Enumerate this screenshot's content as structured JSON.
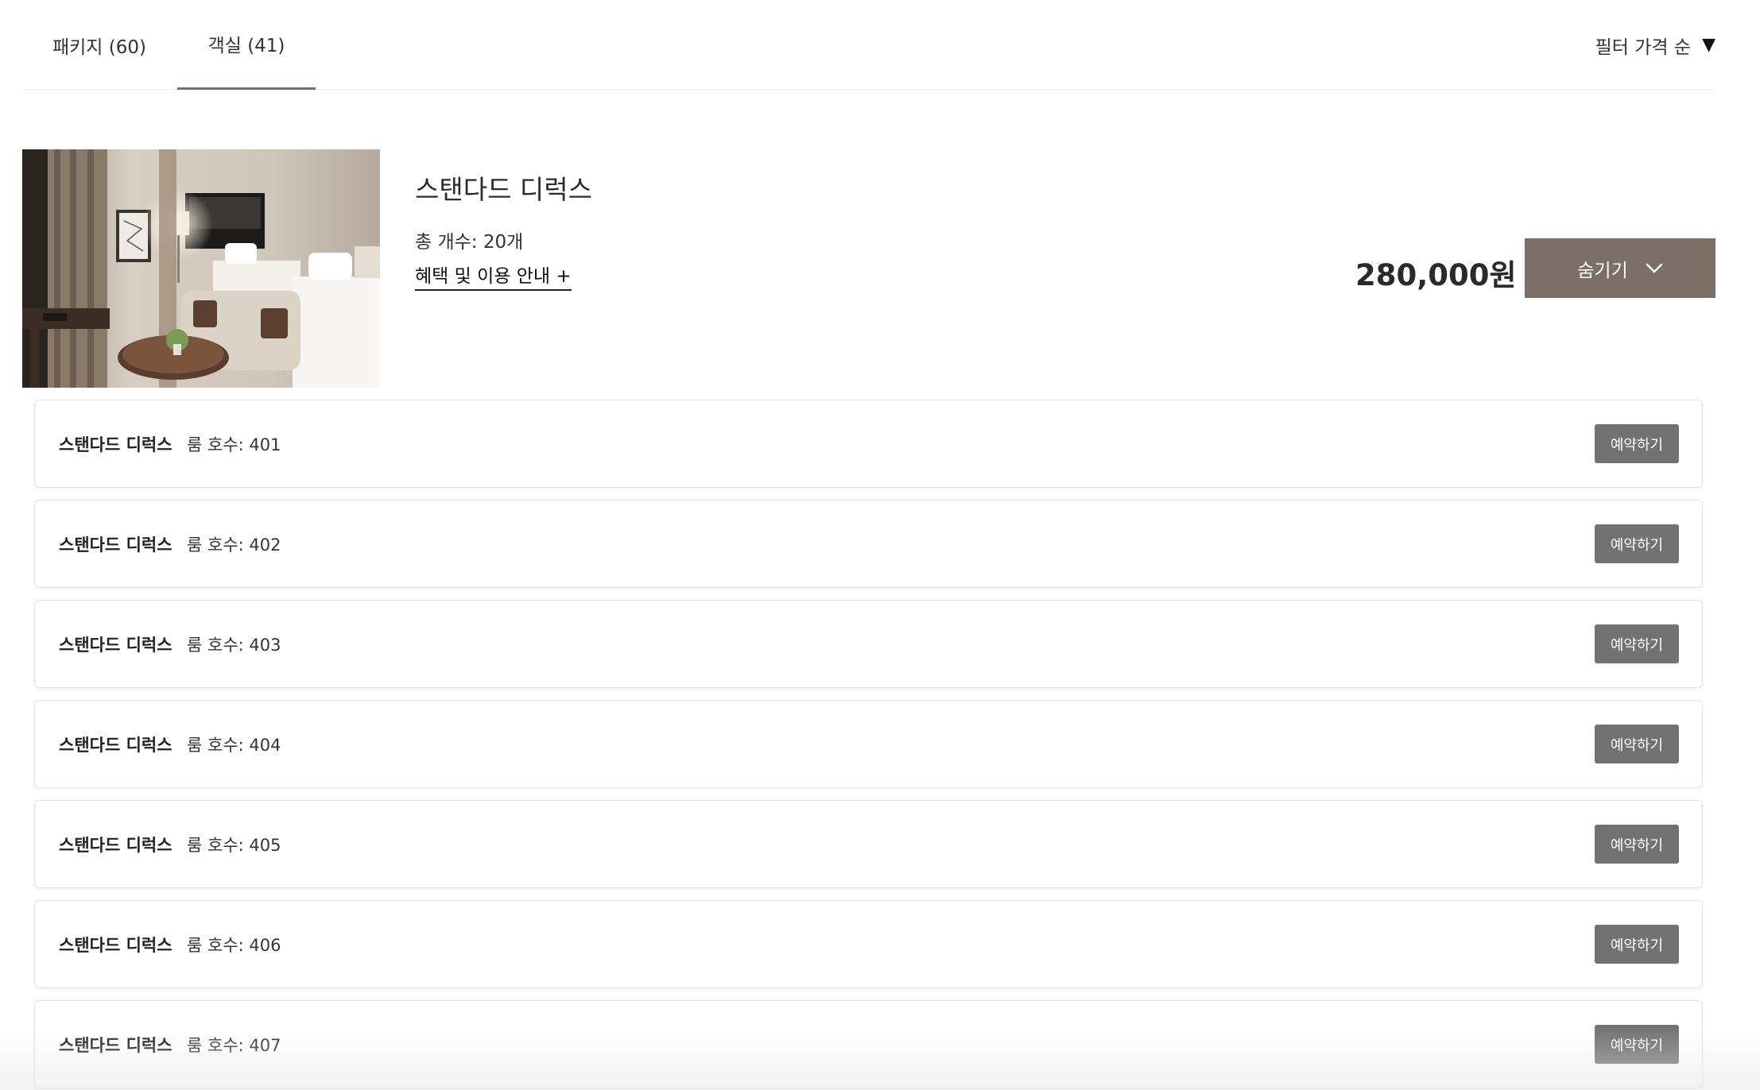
{
  "tabs": [
    {
      "label": "패키지 (60)",
      "active": false
    },
    {
      "label": "객실 (41)",
      "active": true
    }
  ],
  "filter": {
    "label": "필터 가격 순",
    "caret": "▼"
  },
  "room": {
    "title": "스탠다드 디럭스",
    "count": "총 개수: 20개",
    "benefits_link": "혜택 및 이용 안내 +",
    "price": "280,000원",
    "hide_label": "숨기기"
  },
  "units": [
    {
      "name": "스탠다드 디럭스",
      "room_no": "룸 호수: 401",
      "book_label": "예약하기"
    },
    {
      "name": "스탠다드 디럭스",
      "room_no": "룸 호수: 402",
      "book_label": "예약하기"
    },
    {
      "name": "스탠다드 디럭스",
      "room_no": "룸 호수: 403",
      "book_label": "예약하기"
    },
    {
      "name": "스탠다드 디럭스",
      "room_no": "룸 호수: 404",
      "book_label": "예약하기"
    },
    {
      "name": "스탠다드 디럭스",
      "room_no": "룸 호수: 405",
      "book_label": "예약하기"
    },
    {
      "name": "스탠다드 디럭스",
      "room_no": "룸 호수: 406",
      "book_label": "예약하기"
    },
    {
      "name": "스탠다드 디럭스",
      "room_no": "룸 호수: 407",
      "book_label": "예약하기"
    }
  ],
  "colors": {
    "accent": "#7c6f67",
    "tab_underline": "#7a6e67",
    "book_button": "#727272"
  }
}
